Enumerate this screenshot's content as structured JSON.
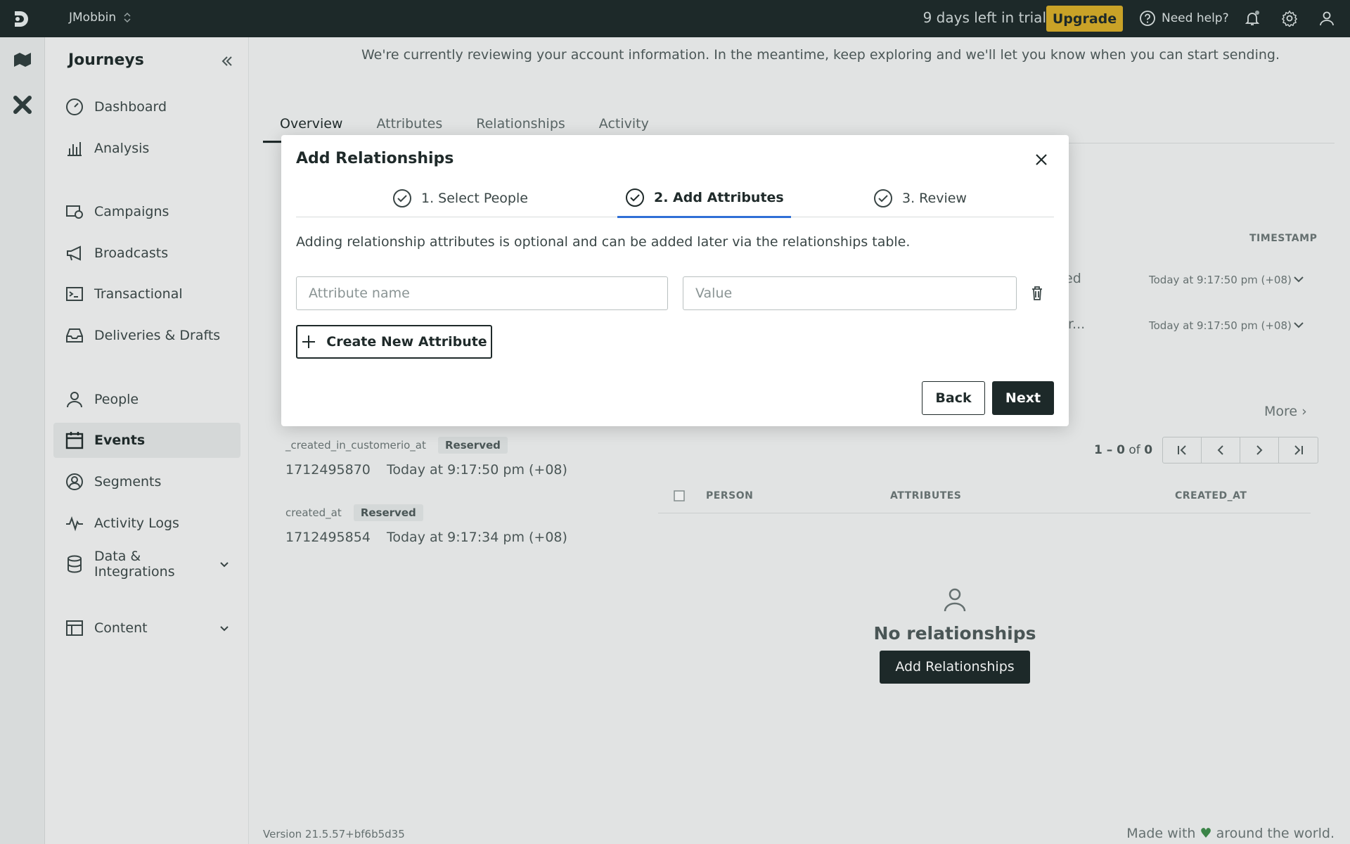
{
  "topbar": {
    "workspace": "JMobbin",
    "trial_text": "9 days left in trial",
    "upgrade_label": "Upgrade",
    "help_label": "Need help?"
  },
  "sidebar": {
    "title": "Journeys",
    "items": [
      {
        "label": "Dashboard",
        "icon": "dashboard-icon"
      },
      {
        "label": "Analysis",
        "icon": "bar-chart-icon"
      },
      {
        "label": "Campaigns",
        "icon": "campaigns-icon"
      },
      {
        "label": "Broadcasts",
        "icon": "megaphone-icon"
      },
      {
        "label": "Transactional",
        "icon": "terminal-icon"
      },
      {
        "label": "Deliveries & Drafts",
        "icon": "inbox-icon"
      },
      {
        "label": "People",
        "icon": "person-icon"
      },
      {
        "label": "Events",
        "icon": "calendar-icon",
        "active": true
      },
      {
        "label": "Segments",
        "icon": "segments-icon"
      },
      {
        "label": "Activity Logs",
        "icon": "pulse-icon"
      },
      {
        "label": "Data & Integrations",
        "icon": "database-icon"
      },
      {
        "label": "Content",
        "icon": "content-icon"
      }
    ]
  },
  "footer": {
    "version": "Version 21.5.57+bf6b5d35",
    "made_with_prefix": "Made with",
    "made_with_suffix": "around the world."
  },
  "main": {
    "banner": "We're currently reviewing your account information. In the meantime, keep exploring and we'll let you know when you can start sending.",
    "tabs": [
      "Overview",
      "Attributes",
      "Relationships",
      "Activity"
    ],
    "timestamp_header": "TIMESTAMP",
    "activity_rows": [
      {
        "name": "ged",
        "time": "Today at 9:17:50 pm (+08)"
      },
      {
        "name": "ier...",
        "time": "Today at 9:17:50 pm (+08)"
      }
    ],
    "more_label": "More",
    "attributes": [
      {
        "key": "_created_in_customerio_at",
        "badge": "Reserved",
        "value": "1712495870",
        "time": "Today at 9:17:50 pm (+08)"
      },
      {
        "key": "created_at",
        "badge": "Reserved",
        "value": "1712495854",
        "time": "Today at 9:17:34 pm (+08)"
      }
    ],
    "relationships": {
      "pager_range": "1 – 0",
      "pager_of": "of",
      "pager_total": "0",
      "columns": [
        "PERSON",
        "ATTRIBUTES",
        "CREATED_AT"
      ],
      "empty_text": "No relationships",
      "add_label": "Add Relationships"
    }
  },
  "modal": {
    "title": "Add Relationships",
    "steps": [
      "1. Select People",
      "2. Add Attributes",
      "3. Review"
    ],
    "active_step": 1,
    "description": "Adding relationship attributes is optional and can be added later via the relationships table.",
    "attribute_placeholder": "Attribute name",
    "value_placeholder": "Value",
    "create_label": "Create New Attribute",
    "back_label": "Back",
    "next_label": "Next"
  },
  "colors": {
    "topbar": "#1d2929",
    "upgrade": "#c9a227",
    "active_step": "#2f6fd6",
    "primary_button": "#1d2929"
  }
}
